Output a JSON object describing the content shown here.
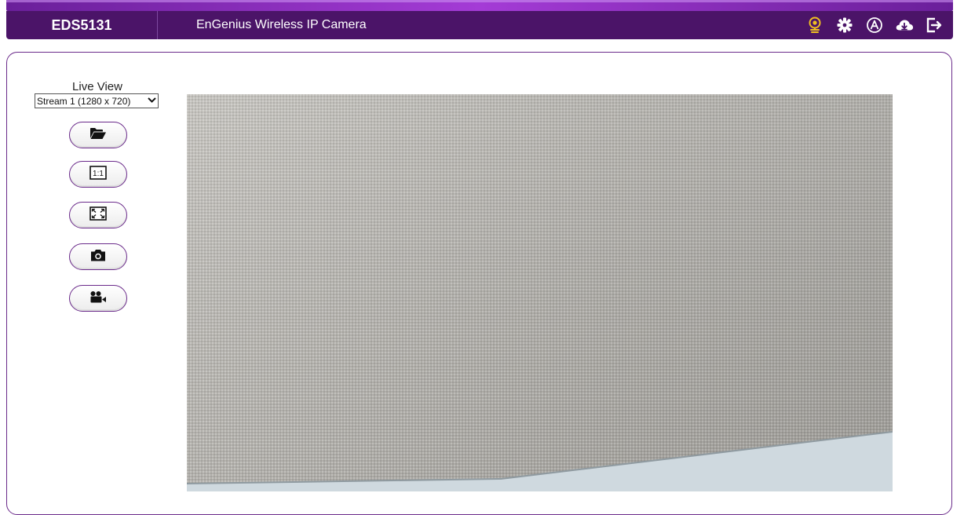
{
  "header": {
    "device_name": "EDS5131",
    "title": "EnGenius Wireless IP Camera",
    "icons": [
      "webcam-icon",
      "gear-icon",
      "admin-icon",
      "cloud-download-icon",
      "logout-icon"
    ]
  },
  "sidebar": {
    "live_view_label": "Live View",
    "stream_select_value": "Stream 1 (1280 x 720)",
    "buttons": [
      {
        "name": "open-folder",
        "icon": "folder-open-icon"
      },
      {
        "name": "original-size",
        "icon": "ratio-1-1-icon",
        "label": "1:1"
      },
      {
        "name": "fullscreen",
        "icon": "expand-icon"
      },
      {
        "name": "snapshot",
        "icon": "camera-icon"
      },
      {
        "name": "record",
        "icon": "video-record-icon"
      }
    ]
  },
  "colors": {
    "header_bg": "#4b1468",
    "accent": "#a43bd6",
    "border": "#6a2a8a"
  }
}
